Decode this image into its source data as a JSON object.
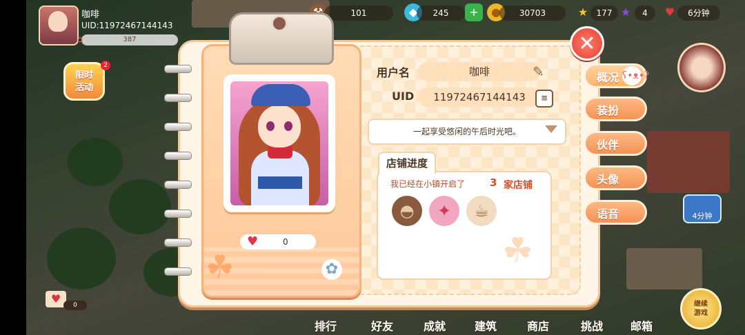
{
  "hud": {
    "player_name": "咖啡",
    "uid": "UID:11972467144143",
    "house_level": "387",
    "resources": [
      {
        "name": "hammer",
        "value": "101"
      },
      {
        "name": "diamond",
        "value": "245"
      },
      {
        "name": "coin",
        "value": "30703"
      },
      {
        "name": "star",
        "value": "177"
      },
      {
        "name": "purple-star",
        "value": "4"
      },
      {
        "name": "strawberry-timer",
        "value": "6分钟"
      }
    ]
  },
  "event": {
    "label": "限时\n活动",
    "badge": "2"
  },
  "left_like_count": "0",
  "profile": {
    "username_label": "用户名",
    "username": "咖啡",
    "uid_label": "UID",
    "uid": "11972467144143",
    "motto": "一起享受悠闲的午后时光吧。",
    "likes": "0",
    "shop_tab": "店铺进度",
    "shop_text": "我已经在小镇开启了",
    "shop_count": "3",
    "shop_unit": "家店铺"
  },
  "side_tabs": [
    "概况",
    "装扮",
    "伙伴",
    "头像",
    "语音"
  ],
  "bottom_nav": [
    "排行",
    "好友",
    "成就",
    "建筑",
    "商店",
    "挑战",
    "邮箱"
  ],
  "continue_label": "继续\n游戏",
  "right_widget_time": "4分钟"
}
